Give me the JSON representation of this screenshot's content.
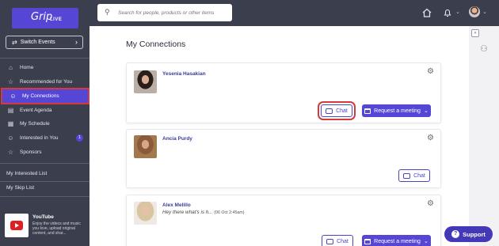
{
  "brand": {
    "logo_main": "Grip",
    "logo_sub": "LIVE"
  },
  "sidebar": {
    "switch_events": "Switch Events",
    "items": [
      {
        "label": "Home",
        "icon": "home-icon"
      },
      {
        "label": "Recommended for You",
        "icon": "star-icon"
      },
      {
        "label": "My Connections",
        "icon": "handshake-icon",
        "active": true
      },
      {
        "label": "Event Agenda",
        "icon": "agenda-icon"
      },
      {
        "label": "My Schedule",
        "icon": "calendar-icon"
      },
      {
        "label": "Interested in You",
        "icon": "smile-icon",
        "badge": "1"
      },
      {
        "label": "Sponsors",
        "icon": "star-icon"
      }
    ],
    "interested_list": "My Interested List",
    "skip_list": "My Skip List",
    "promo": {
      "title": "YouTube",
      "description": "Enjoy the videos and music you love, upload original content, and shar..."
    }
  },
  "topbar": {
    "search_placeholder": "Search for people, products or other items"
  },
  "main": {
    "title": "My Connections",
    "connections": [
      {
        "name": "Yesenia Hasakian",
        "message": "",
        "time": "",
        "chat_label": "Chat",
        "meeting_label": "Request a meeting"
      },
      {
        "name": "Ancia Purdy",
        "message": "",
        "time": "",
        "chat_label": "Chat",
        "meeting_label": ""
      },
      {
        "name": "Alex Melillo",
        "message": "Hey there what's is h...",
        "time": "(06 Oct 2:45am)",
        "chat_label": "Chat",
        "meeting_label": "Request a meeting"
      }
    ]
  },
  "support": {
    "label": "Support"
  },
  "colors": {
    "accent": "#5546d6",
    "sidebar_bg": "#3b3f4d",
    "highlight": "#d63a3a"
  }
}
